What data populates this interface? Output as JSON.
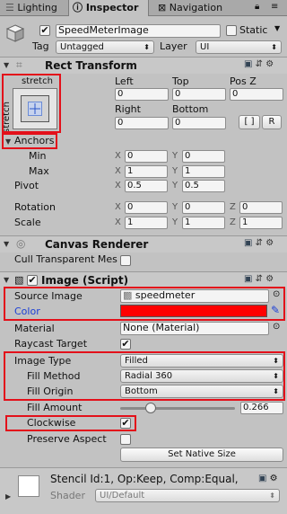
{
  "tabs": {
    "lighting": "Lighting",
    "inspector": "Inspector",
    "navigation": "Navigation"
  },
  "gameobject": {
    "name": "SpeedMeterImage",
    "active": true,
    "static_label": "Static",
    "tag_label": "Tag",
    "tag_value": "Untagged",
    "layer_label": "Layer",
    "layer_value": "UI"
  },
  "rect_transform": {
    "title": "Rect Transform",
    "anchor_preset_top": "stretch",
    "anchor_preset_side": "stretch",
    "col_left": "Left",
    "col_top": "Top",
    "col_posz": "Pos Z",
    "left": "0",
    "top": "0",
    "posz": "0",
    "col_right": "Right",
    "col_bottom": "Bottom",
    "right": "0",
    "bottom": "0",
    "blueprint_btn": "[ ]",
    "raw_btn": "R",
    "anchors_label": "Anchors",
    "min_label": "Min",
    "min_x": "0",
    "min_y": "0",
    "max_label": "Max",
    "max_x": "1",
    "max_y": "1",
    "pivot_label": "Pivot",
    "pivot_x": "0.5",
    "pivot_y": "0.5",
    "rotation_label": "Rotation",
    "rot_x": "0",
    "rot_y": "0",
    "rot_z": "0",
    "scale_label": "Scale",
    "scale_x": "1",
    "scale_y": "1",
    "scale_z": "1",
    "axis_x": "X",
    "axis_y": "Y",
    "axis_z": "Z"
  },
  "canvas_renderer": {
    "title": "Canvas Renderer",
    "cull_label": "Cull Transparent Mes",
    "cull_checked": false
  },
  "image": {
    "title": "Image (Script)",
    "source_image_label": "Source Image",
    "source_image_value": "speedmeter",
    "color_label": "Color",
    "color_value": "#ff0000",
    "material_label": "Material",
    "material_value": "None (Material)",
    "raycast_label": "Raycast Target",
    "raycast_checked": true,
    "image_type_label": "Image Type",
    "image_type_value": "Filled",
    "fill_method_label": "Fill Method",
    "fill_method_value": "Radial 360",
    "fill_origin_label": "Fill Origin",
    "fill_origin_value": "Bottom",
    "fill_amount_label": "Fill Amount",
    "fill_amount_value": "0.266",
    "clockwise_label": "Clockwise",
    "clockwise_checked": true,
    "preserve_label": "Preserve Aspect",
    "preserve_checked": false,
    "set_native_btn": "Set Native Size"
  },
  "material_preview": {
    "stencil_text": "Stencil Id:1, Op:Keep, Comp:Equal,",
    "shader_label": "Shader",
    "shader_value": "UI/Default"
  },
  "colors": {
    "highlight_red": "#e3101a",
    "color_swatch": "#ff0000",
    "color_label_blue": "#1a3fd6"
  }
}
